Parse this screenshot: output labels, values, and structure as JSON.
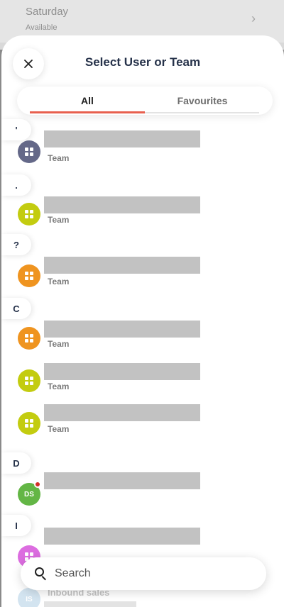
{
  "background": {
    "row_title": "Saturday",
    "row_subtitle": "Available",
    "chevron": "›"
  },
  "header": {
    "title": "Select User or Team",
    "close_icon": "×"
  },
  "tabs": [
    {
      "label": "All",
      "active": true
    },
    {
      "label": "Favourites",
      "active": false
    }
  ],
  "sections": {
    "apostrophe": "'",
    "dot": ".",
    "question": "?",
    "c": "C",
    "d": "D",
    "i": "I"
  },
  "items": {
    "team_label": "Team",
    "ds_initials": "DS",
    "is_initials": "IS",
    "inbound_label": "Inbound sales"
  },
  "colors": {
    "accent": "#e8604f",
    "title": "#26324a",
    "avatar_slate": "#646888",
    "avatar_lime": "#c3cc10",
    "avatar_orange": "#ef9420",
    "avatar_green": "#63b645",
    "avatar_pink": "#dc6de0",
    "avatar_lightblue": "#9ec4e0",
    "presence_red": "#d22f27"
  },
  "search": {
    "placeholder": "Search"
  }
}
